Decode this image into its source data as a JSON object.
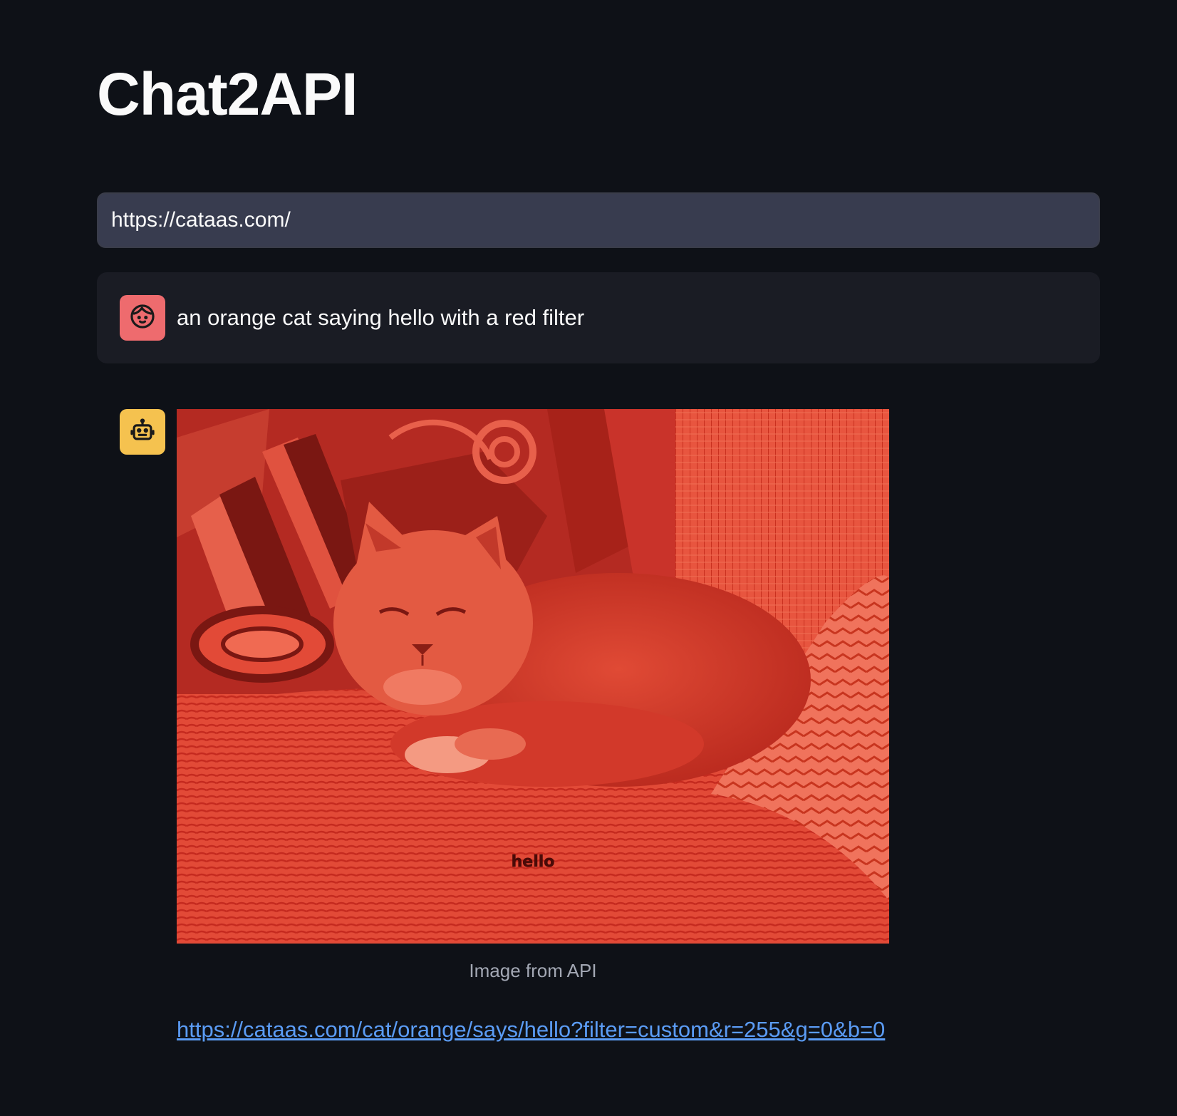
{
  "app": {
    "title": "Chat2API"
  },
  "url_input": {
    "value": "https://cataas.com/"
  },
  "messages": [
    {
      "role": "user",
      "avatar_icon": "user-face-icon",
      "avatar_color": "#ee6b6e",
      "text": "an orange cat saying hello with a red filter"
    },
    {
      "role": "assistant",
      "avatar_icon": "robot-icon",
      "avatar_color": "#f5c24f",
      "image": {
        "caption": "Image from API",
        "overlay_text": "hello",
        "filter_color": "#d9362a"
      },
      "link": "https://cataas.com/cat/orange/says/hello?filter=custom&r=255&g=0&b=0"
    }
  ]
}
